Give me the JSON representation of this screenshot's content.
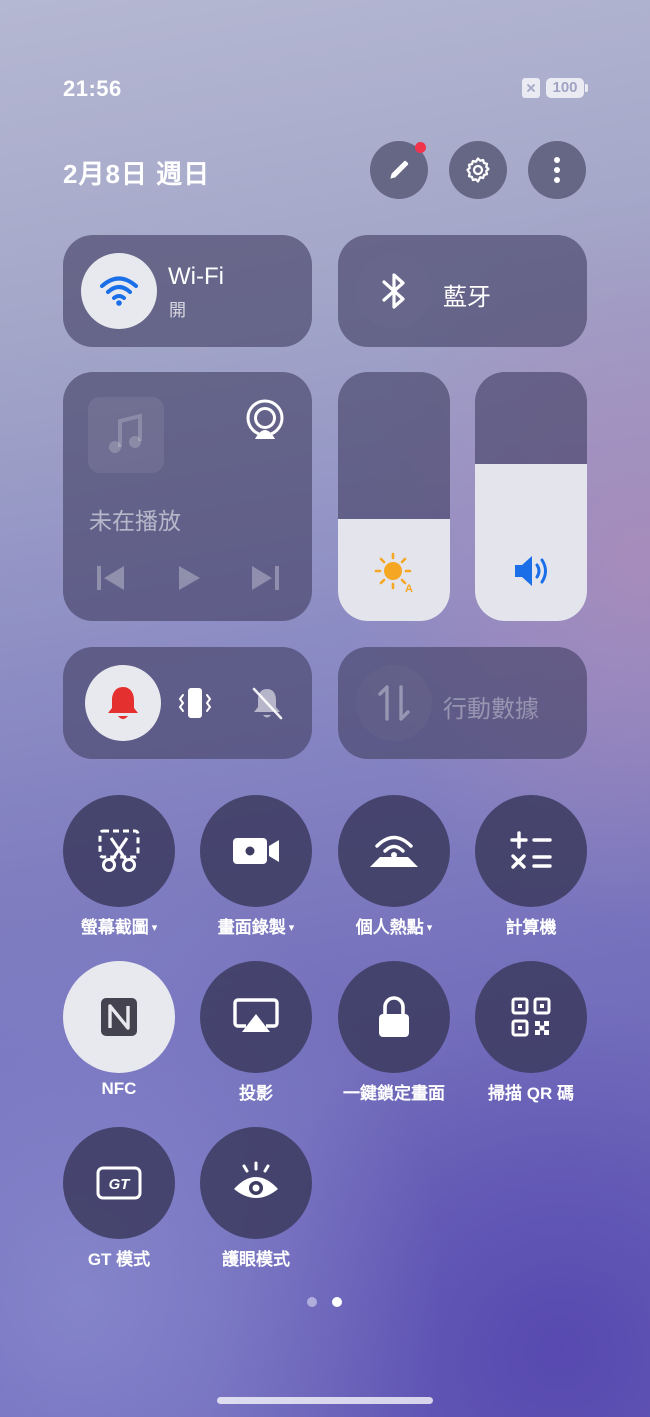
{
  "status_bar": {
    "time": "21:56",
    "battery": "100"
  },
  "header": {
    "date": "2月8日 週日"
  },
  "wifi": {
    "label": "Wi-Fi",
    "status": "開"
  },
  "bluetooth": {
    "label": "藍牙"
  },
  "media": {
    "status": "未在播放"
  },
  "brightness": {
    "level": 0.41
  },
  "volume": {
    "level": 0.63
  },
  "sound_mode": {
    "active": "ring"
  },
  "mobile_data": {
    "label": "行動數據"
  },
  "quick_settings": [
    {
      "label": "螢幕截圖",
      "caret": "▾",
      "icon": "screenshot-scissors-icon"
    },
    {
      "label": "畫面錄製",
      "caret": "▾",
      "icon": "screen-record-icon"
    },
    {
      "label": "個人熱點",
      "caret": "▾",
      "icon": "hotspot-icon"
    },
    {
      "label": "計算機",
      "caret": "",
      "icon": "calculator-icon"
    },
    {
      "label": "NFC",
      "caret": "",
      "icon": "nfc-icon",
      "active": true
    },
    {
      "label": "投影",
      "caret": "",
      "icon": "screen-cast-icon"
    },
    {
      "label": "一鍵鎖定畫面",
      "caret": "",
      "icon": "lock-icon"
    },
    {
      "label": "掃描 QR 碼",
      "caret": "",
      "icon": "qr-scan-icon"
    },
    {
      "label": "GT 模式",
      "caret": "",
      "icon": "gt-mode-icon"
    },
    {
      "label": "護眼模式",
      "caret": "",
      "icon": "eye-comfort-icon"
    }
  ],
  "gt_icon_text": "GT",
  "pager": {
    "pages": 2,
    "current": 2
  },
  "colors": {
    "wifi_accent": "#1a6fe8",
    "bell_red": "#e53030",
    "sun_orange": "#f5a623",
    "badge_red": "#f0344c"
  }
}
